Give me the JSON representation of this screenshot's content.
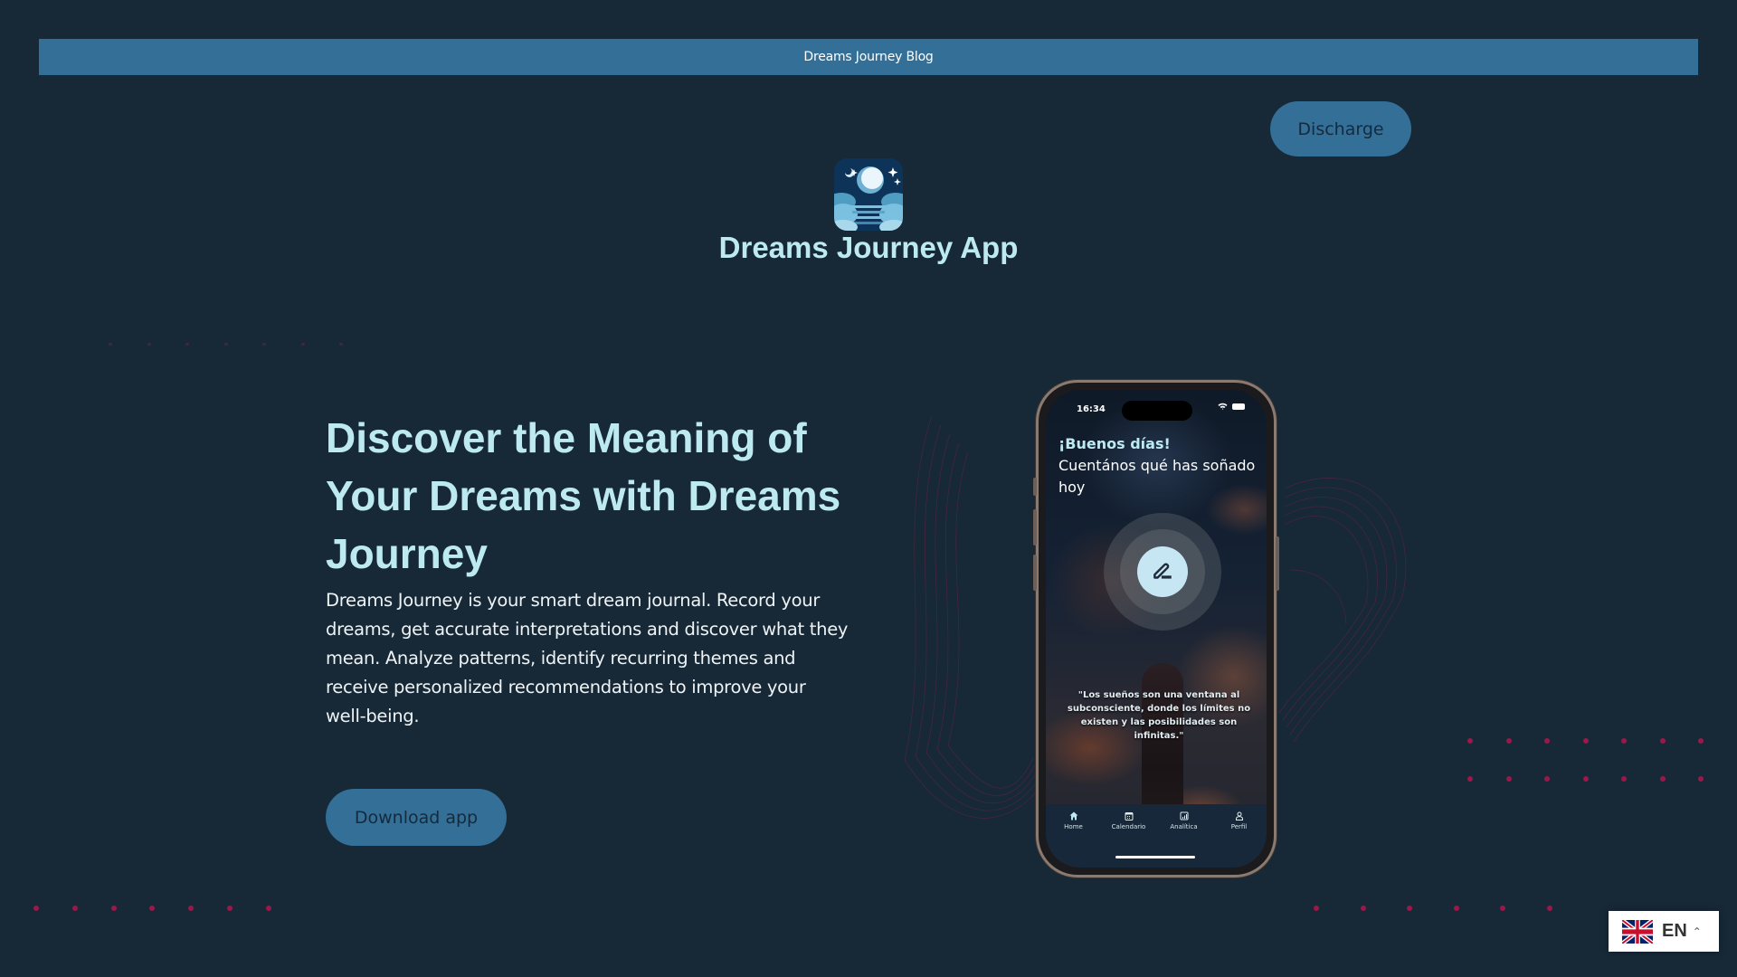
{
  "topbar": {
    "link_label": "Dreams Journey Blog"
  },
  "header": {
    "discharge_label": "Discharge",
    "logo_icon": "moon-clouds-app-icon",
    "app_title": "Dreams Journey App"
  },
  "hero": {
    "title": "Discover the Meaning of Your Dreams with Dreams Journey",
    "description": "Dreams Journey is your smart dream journal. Record your dreams, get accurate interpretations and discover what they mean. Analyze patterns, identify recurring themes and receive personalized recommendations to improve your well-being.",
    "download_label": "Download app"
  },
  "phone": {
    "status_time": "16:34",
    "greeting": "¡Buenos días!",
    "prompt": "Cuentános qué has soñado hoy",
    "record_icon": "edit-pencil-icon",
    "quote": "\"Los sueños son una ventana al subconsciente, donde los límites no existen y las posibilidades son infinitas.\"",
    "tabs": [
      {
        "label": "Home",
        "icon": "home-icon"
      },
      {
        "label": "Calendario",
        "icon": "calendar-icon"
      },
      {
        "label": "Analítica",
        "icon": "analytics-icon"
      },
      {
        "label": "Perfil",
        "icon": "profile-icon"
      }
    ]
  },
  "language": {
    "code": "EN",
    "flag": "uk-flag-icon"
  },
  "colors": {
    "background": "#172837",
    "accent": "#336f96",
    "heading": "#bdeaf1",
    "dots": "#9c1848"
  }
}
